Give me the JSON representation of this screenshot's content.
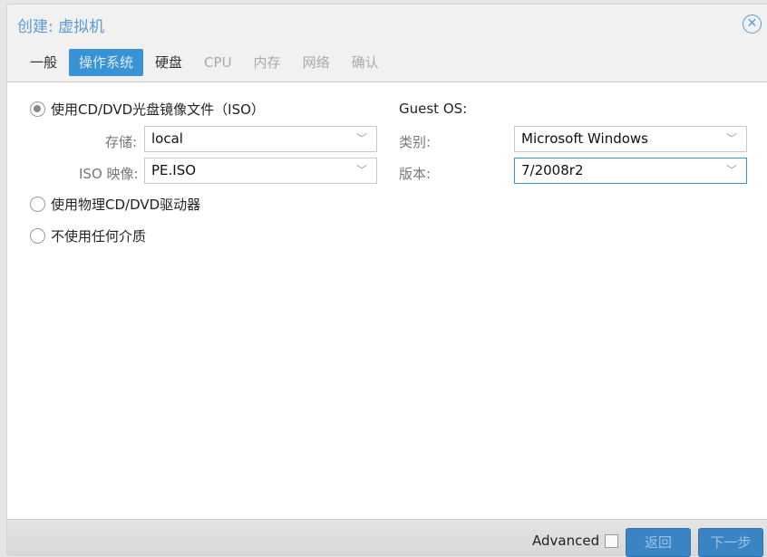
{
  "window": {
    "title": "创建: 虚拟机"
  },
  "tabs": [
    {
      "label": "一般"
    },
    {
      "label": "操作系统"
    },
    {
      "label": "硬盘"
    },
    {
      "label": "CPU"
    },
    {
      "label": "内存"
    },
    {
      "label": "网络"
    },
    {
      "label": "确认"
    }
  ],
  "media": {
    "use_iso": "使用CD/DVD光盘镜像文件（ISO）",
    "storage_label": "存储:",
    "storage_value": "local",
    "iso_label": "ISO 映像:",
    "iso_value": "PE.ISO",
    "use_physical": "使用物理CD/DVD驱动器",
    "no_media": "不使用任何介质",
    "selected": "use_iso"
  },
  "guest": {
    "heading": "Guest OS:",
    "type_label": "类别:",
    "type_value": "Microsoft Windows",
    "version_label": "版本:",
    "version_value": "7/2008r2"
  },
  "footer": {
    "advanced": "Advanced",
    "advanced_checked": false,
    "back": "返回",
    "next": "下一步"
  }
}
